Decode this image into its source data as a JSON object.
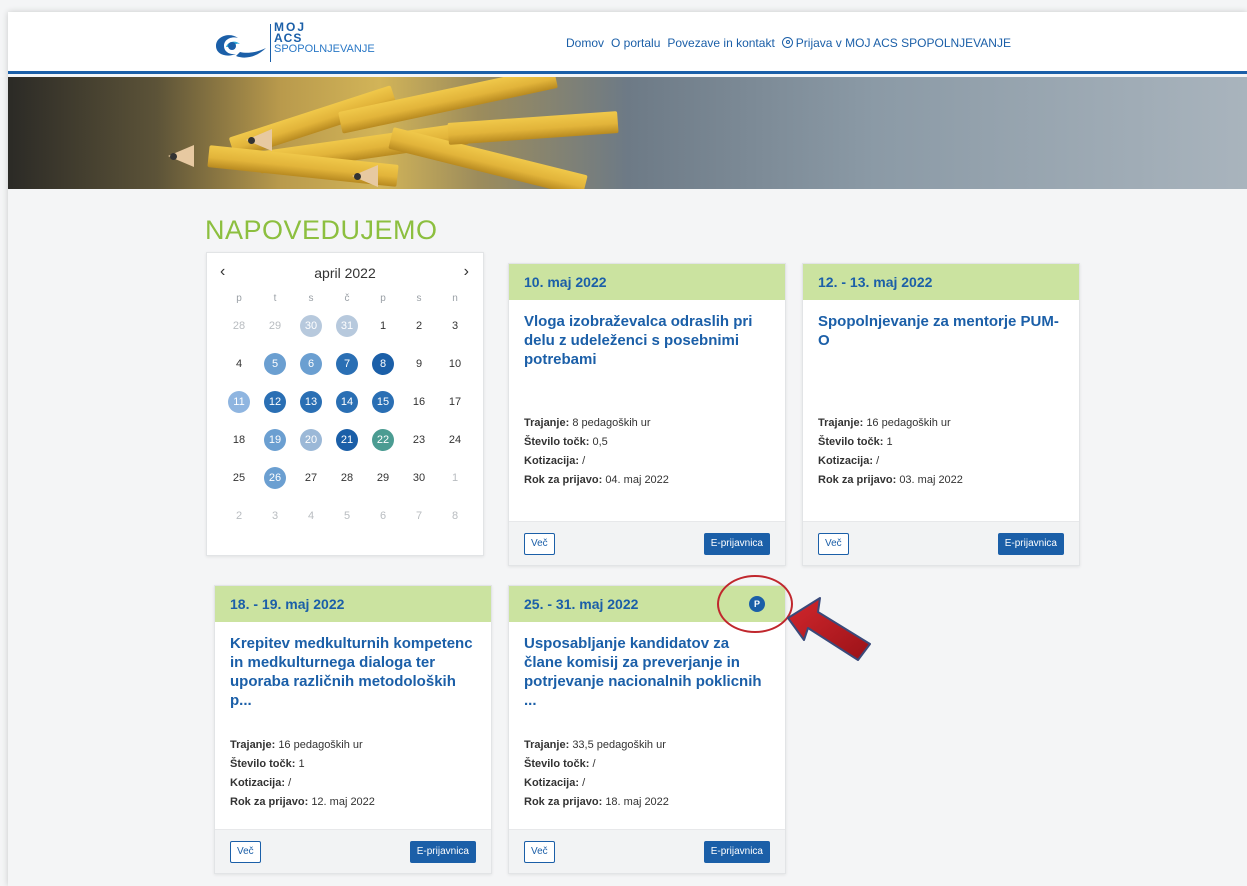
{
  "logo": {
    "line1": "MOJ",
    "line2": "ACS",
    "line3": "SPOPOLNJEVANJE"
  },
  "nav": {
    "items": [
      "Domov",
      "O portalu",
      "Povezave in kontakt"
    ],
    "login": "Prijava v MOJ ACS SPOPOLNJEVANJE"
  },
  "section_title": "NAPOVEDUJEMO",
  "calendar": {
    "month": "april 2022",
    "prev": "‹",
    "next": "›",
    "weekdays": [
      "p",
      "t",
      "s",
      "č",
      "p",
      "s",
      "n"
    ],
    "days": [
      {
        "n": "28",
        "s": "muted"
      },
      {
        "n": "29",
        "s": "muted"
      },
      {
        "n": "30",
        "s": "e6"
      },
      {
        "n": "31",
        "s": "e6"
      },
      {
        "n": "1",
        "s": ""
      },
      {
        "n": "2",
        "s": ""
      },
      {
        "n": "3",
        "s": ""
      },
      {
        "n": "4",
        "s": ""
      },
      {
        "n": "5",
        "s": "e1"
      },
      {
        "n": "6",
        "s": "e1"
      },
      {
        "n": "7",
        "s": "e2"
      },
      {
        "n": "8",
        "s": "e3"
      },
      {
        "n": "9",
        "s": ""
      },
      {
        "n": "10",
        "s": ""
      },
      {
        "n": "11",
        "s": "e7"
      },
      {
        "n": "12",
        "s": "e2"
      },
      {
        "n": "13",
        "s": "e2"
      },
      {
        "n": "14",
        "s": "e2"
      },
      {
        "n": "15",
        "s": "e2"
      },
      {
        "n": "16",
        "s": ""
      },
      {
        "n": "17",
        "s": ""
      },
      {
        "n": "18",
        "s": ""
      },
      {
        "n": "19",
        "s": "e1"
      },
      {
        "n": "20",
        "s": "e5"
      },
      {
        "n": "21",
        "s": "e3"
      },
      {
        "n": "22",
        "s": "e4"
      },
      {
        "n": "23",
        "s": ""
      },
      {
        "n": "24",
        "s": ""
      },
      {
        "n": "25",
        "s": ""
      },
      {
        "n": "26",
        "s": "e1"
      },
      {
        "n": "27",
        "s": ""
      },
      {
        "n": "28",
        "s": ""
      },
      {
        "n": "29",
        "s": ""
      },
      {
        "n": "30",
        "s": ""
      },
      {
        "n": "1",
        "s": "muted"
      },
      {
        "n": "2",
        "s": "muted"
      },
      {
        "n": "3",
        "s": "muted"
      },
      {
        "n": "4",
        "s": "muted"
      },
      {
        "n": "5",
        "s": "muted"
      },
      {
        "n": "6",
        "s": "muted"
      },
      {
        "n": "7",
        "s": "muted"
      },
      {
        "n": "8",
        "s": "muted"
      }
    ]
  },
  "labels": {
    "trajanje": "Trajanje:",
    "tocke": "Število točk:",
    "kotizacija": "Kotizacija:",
    "rok": "Rok za prijavo:",
    "vec": "Več",
    "eprijavnica": "E-prijavnica"
  },
  "cards": [
    {
      "date": "10. maj 2022",
      "title": "Vloga izobraževalca odraslih pri delu z udeleženci s posebnimi potrebami",
      "trajanje": "8 pedagoških ur",
      "tocke": "0,5",
      "kotizacija": "/",
      "rok": "04. maj 2022"
    },
    {
      "date": "12. - 13. maj 2022",
      "title": "Spopolnjevanje za mentorje PUM-O",
      "trajanje": "16 pedagoških ur",
      "tocke": "1",
      "kotizacija": "/",
      "rok": "03. maj 2022"
    },
    {
      "date": "18. - 19. maj 2022",
      "title": "Krepitev medkulturnih kompetenc in medkulturnega dialoga ter uporaba različnih metodoloških p...",
      "trajanje": "16 pedagoških ur",
      "tocke": "1",
      "kotizacija": "/",
      "rok": "12. maj 2022"
    },
    {
      "date": "25. - 31. maj 2022",
      "badge": "P",
      "title": "Usposabljanje kandidatov za člane komisij za preverjanje in potrjevanje nacionalnih poklicnih ...",
      "trajanje": "33,5 pedagoških ur",
      "tocke": "/",
      "kotizacija": "/",
      "rok": "18. maj 2022"
    }
  ],
  "colors": {
    "brand_blue": "#1b5fa8",
    "title_green": "#8cbf3f",
    "card_header": "#cbe3a0",
    "annotation_red": "#c0272d"
  }
}
